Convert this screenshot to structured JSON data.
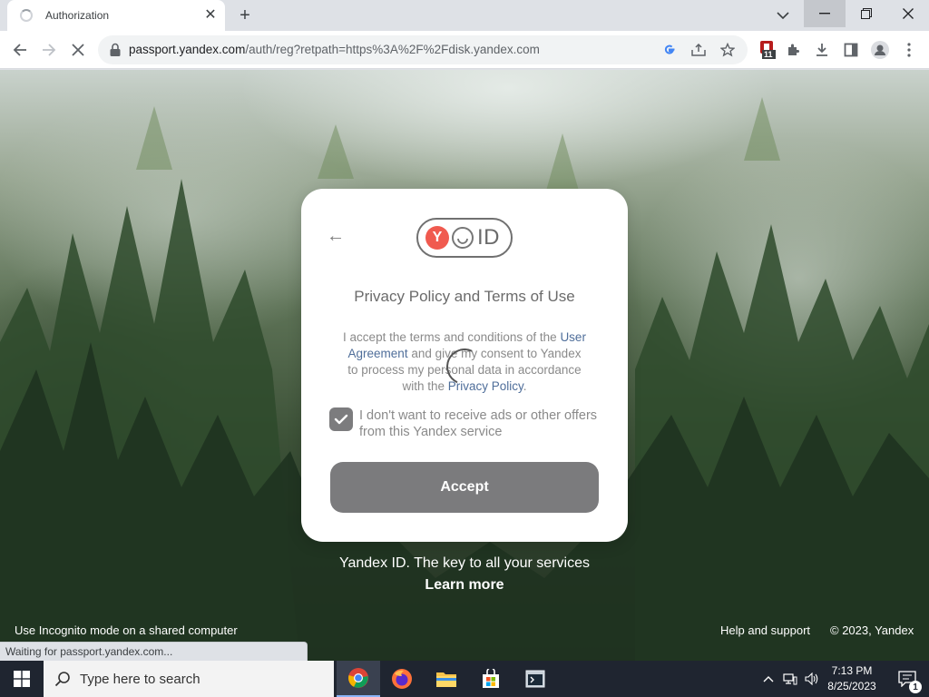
{
  "browser": {
    "tab_title": "Authorization",
    "tab_close": "✕",
    "new_tab": "+",
    "url_host": "passport.yandex.com",
    "url_path": "/auth/reg?retpath=https%3A%2F%2Fdisk.yandex.com",
    "extension_badge": "11",
    "status_text": "Waiting for passport.yandex.com..."
  },
  "card": {
    "back_arrow": "←",
    "logo_letter": "Y",
    "logo_id": "ID",
    "title": "Privacy Policy and Terms of Use",
    "terms_part1": "I accept the terms and conditions of the ",
    "terms_link1": "User Agreement",
    "terms_part2": " and give my consent to Yandex to process my personal data in accordance with the ",
    "terms_link2": "Privacy Policy",
    "terms_part3": ".",
    "checkbox_label": "I don't want to receive ads or other offers from this Yandex service",
    "checkbox_checked": true,
    "accept_label": "Accept"
  },
  "footer": {
    "tagline": "Yandex ID. The key to all your services",
    "learn_more": "Learn more",
    "incognito_note": "Use Incognito mode on a shared computer",
    "help": "Help and support",
    "copyright": "© 2023, Yandex"
  },
  "taskbar": {
    "search_placeholder": "Type here to search",
    "time": "7:13 PM",
    "date": "8/25/2023",
    "notification_count": "1"
  },
  "colors": {
    "accept_button": "#7b7b7d",
    "link": "#4f6e9a",
    "logo_red": "#f05a4f",
    "taskbar": "#1f2530"
  }
}
